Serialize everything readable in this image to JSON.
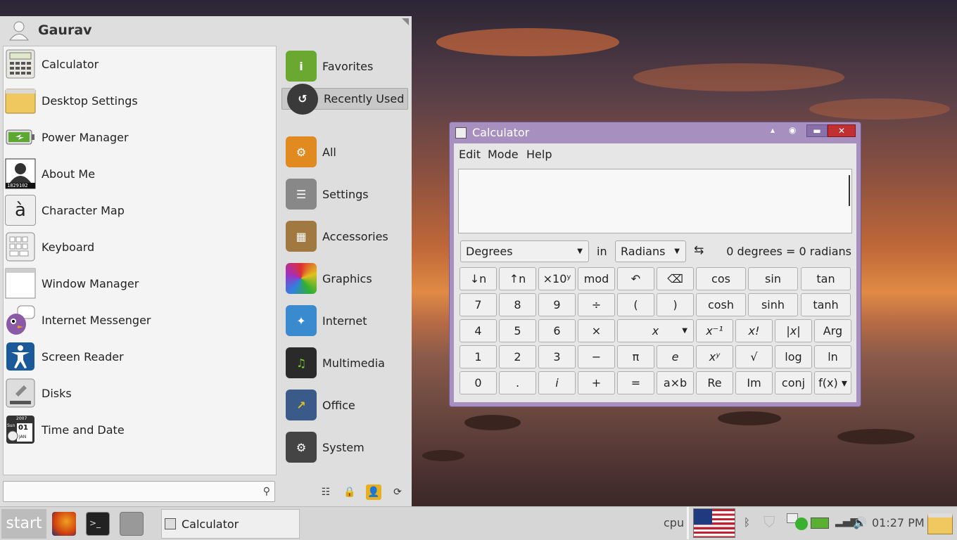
{
  "menu": {
    "username": "Gaurav",
    "apps": [
      {
        "label": "Calculator",
        "icon": "calculator-icon"
      },
      {
        "label": "Desktop Settings",
        "icon": "desktop-settings-icon"
      },
      {
        "label": "Power Manager",
        "icon": "battery-icon"
      },
      {
        "label": "About Me",
        "icon": "id-card-icon"
      },
      {
        "label": "Character Map",
        "icon": "character-map-icon",
        "glyph": "à"
      },
      {
        "label": "Keyboard",
        "icon": "keyboard-icon"
      },
      {
        "label": "Window Manager",
        "icon": "window-icon"
      },
      {
        "label": "Internet Messenger",
        "icon": "pidgin-icon"
      },
      {
        "label": "Screen Reader",
        "icon": "accessibility-icon"
      },
      {
        "label": "Disks",
        "icon": "disk-icon"
      },
      {
        "label": "Time and Date",
        "icon": "calendar-clock-icon"
      }
    ],
    "about_me_id": "1829102",
    "calendar_icon": {
      "year": "2007",
      "day_name": "Sun",
      "day": "01",
      "month": "JAN"
    },
    "categories": [
      {
        "label": "Favorites",
        "color": "#6aa832"
      },
      {
        "label": "Recently Used",
        "color": "#3a3a3a",
        "selected": true
      },
      {
        "label": "All",
        "color": "#e08a20"
      },
      {
        "label": "Settings",
        "color": "#888888"
      },
      {
        "label": "Accessories",
        "color": "#a07840"
      },
      {
        "label": "Graphics",
        "color": "#d04080"
      },
      {
        "label": "Internet",
        "color": "#3a8ad0"
      },
      {
        "label": "Multimedia",
        "color": "#2a2a2a"
      },
      {
        "label": "Office",
        "color": "#3a5a8a"
      },
      {
        "label": "System",
        "color": "#444444"
      }
    ],
    "search_placeholder": ""
  },
  "calculator": {
    "title": "Calculator",
    "menus": [
      "Edit",
      "Mode",
      "Help"
    ],
    "display": "",
    "conversion": {
      "from": "Degrees",
      "in_label": "in",
      "to": "Radians",
      "swap": "⇆",
      "result": "0 degrees = 0 radians"
    },
    "rows": [
      [
        "↓n",
        "↑n",
        "×10ʸ",
        "mod",
        "↶",
        "⌫",
        "cos",
        "sin",
        "tan"
      ],
      [
        "7",
        "8",
        "9",
        "÷",
        "(",
        ")",
        "cosh",
        "sinh",
        "tanh"
      ],
      [
        "4",
        "5",
        "6",
        "×",
        "x",
        "x⁻¹",
        "x!",
        "|x|",
        "Arg"
      ],
      [
        "1",
        "2",
        "3",
        "−",
        "π",
        "e",
        "xʸ",
        "√",
        "log",
        "ln"
      ],
      [
        "0",
        ".",
        "i",
        "+",
        "=",
        "a×b",
        "Re",
        "Im",
        "conj",
        "f(x)"
      ]
    ]
  },
  "taskbar": {
    "start": "start",
    "task_label": "Calculator",
    "cpu": "cpu",
    "time": "01:27 PM"
  }
}
